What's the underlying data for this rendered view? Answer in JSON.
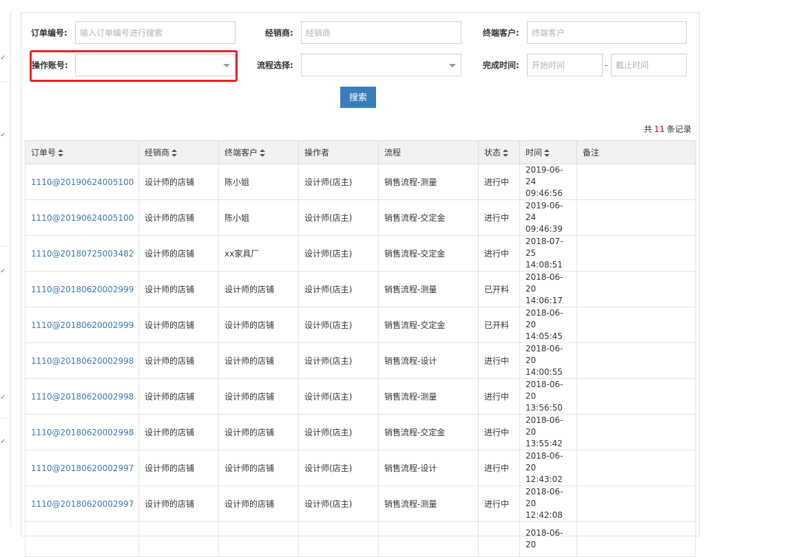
{
  "filters": {
    "order_no": {
      "label": "订单编号:",
      "placeholder": "输入订单编号进行搜索"
    },
    "dealer": {
      "label": "经销商:",
      "placeholder": "经销商"
    },
    "customer": {
      "label": "终端客户:",
      "placeholder": "终端客户"
    },
    "operator": {
      "label": "操作账号:",
      "value": ""
    },
    "process": {
      "label": "流程选择:",
      "value": ""
    },
    "finish_time": {
      "label": "完成时间:",
      "start_placeholder": "开始时间",
      "separator": "-",
      "end_placeholder": "截止时间"
    },
    "search_button": "搜索"
  },
  "records": {
    "prefix": "共",
    "count": "11",
    "suffix": "条记录"
  },
  "table": {
    "headers": [
      "订单号",
      "经销商",
      "终端客户",
      "操作者",
      "流程",
      "状态",
      "时间",
      "备注"
    ],
    "rows": [
      {
        "order": "1110@20190624005100",
        "dealer": "设计师的店铺",
        "customer": "陈小姐",
        "operator": "设计师(店主)",
        "process": "销售流程-测量",
        "status": "进行中",
        "date": "2019-06-24",
        "time": "09:46:56",
        "note": ""
      },
      {
        "order": "1110@20190624005100",
        "dealer": "设计师的店铺",
        "customer": "陈小姐",
        "operator": "设计师(店主)",
        "process": "销售流程-交定金",
        "status": "进行中",
        "date": "2019-06-24",
        "time": "09:46:39",
        "note": ""
      },
      {
        "order": "1110@20180725003482",
        "dealer": "设计师的店铺",
        "customer": "xx家具厂",
        "operator": "设计师(店主)",
        "process": "销售流程-交定金",
        "status": "进行中",
        "date": "2018-07-25",
        "time": "14:08:51",
        "note": ""
      },
      {
        "order": "1110@20180620002999",
        "dealer": "设计师的店铺",
        "customer": "设计师的店铺",
        "operator": "设计师(店主)",
        "process": "销售流程-测量",
        "status": "已开料",
        "date": "2018-06-20",
        "time": "14:06:17",
        "note": ""
      },
      {
        "order": "1110@20180620002999",
        "dealer": "设计师的店铺",
        "customer": "设计师的店铺",
        "operator": "设计师(店主)",
        "process": "销售流程-交定金",
        "status": "已开料",
        "date": "2018-06-20",
        "time": "14:05:45",
        "note": ""
      },
      {
        "order": "1110@20180620002998",
        "dealer": "设计师的店铺",
        "customer": "设计师的店铺",
        "operator": "设计师(店主)",
        "process": "销售流程-设计",
        "status": "进行中",
        "date": "2018-06-20",
        "time": "14:00:55",
        "note": ""
      },
      {
        "order": "1110@20180620002998",
        "dealer": "设计师的店铺",
        "customer": "设计师的店铺",
        "operator": "设计师(店主)",
        "process": "销售流程-测量",
        "status": "进行中",
        "date": "2018-06-20",
        "time": "13:56:50",
        "note": ""
      },
      {
        "order": "1110@20180620002998",
        "dealer": "设计师的店铺",
        "customer": "设计师的店铺",
        "operator": "设计师(店主)",
        "process": "销售流程-交定金",
        "status": "进行中",
        "date": "2018-06-20",
        "time": "13:55:42",
        "note": ""
      },
      {
        "order": "1110@20180620002997",
        "dealer": "设计师的店铺",
        "customer": "设计师的店铺",
        "operator": "设计师(店主)",
        "process": "销售流程-设计",
        "status": "进行中",
        "date": "2018-06-20",
        "time": "12:43:02",
        "note": ""
      },
      {
        "order": "1110@20180620002997",
        "dealer": "设计师的店铺",
        "customer": "设计师的店铺",
        "operator": "设计师(店主)",
        "process": "销售流程-测量",
        "status": "进行中",
        "date": "2018-06-20",
        "time": "12:42:08",
        "note": ""
      },
      {
        "order": "",
        "dealer": "",
        "customer": "",
        "operator": "",
        "process": "",
        "status": "",
        "date": "2018-06-20",
        "time": "",
        "note": ""
      }
    ]
  },
  "colors": {
    "link": "#3a78b5",
    "button": "#3a7dbc",
    "highlight": "#e22424",
    "count": "#d0021b"
  }
}
